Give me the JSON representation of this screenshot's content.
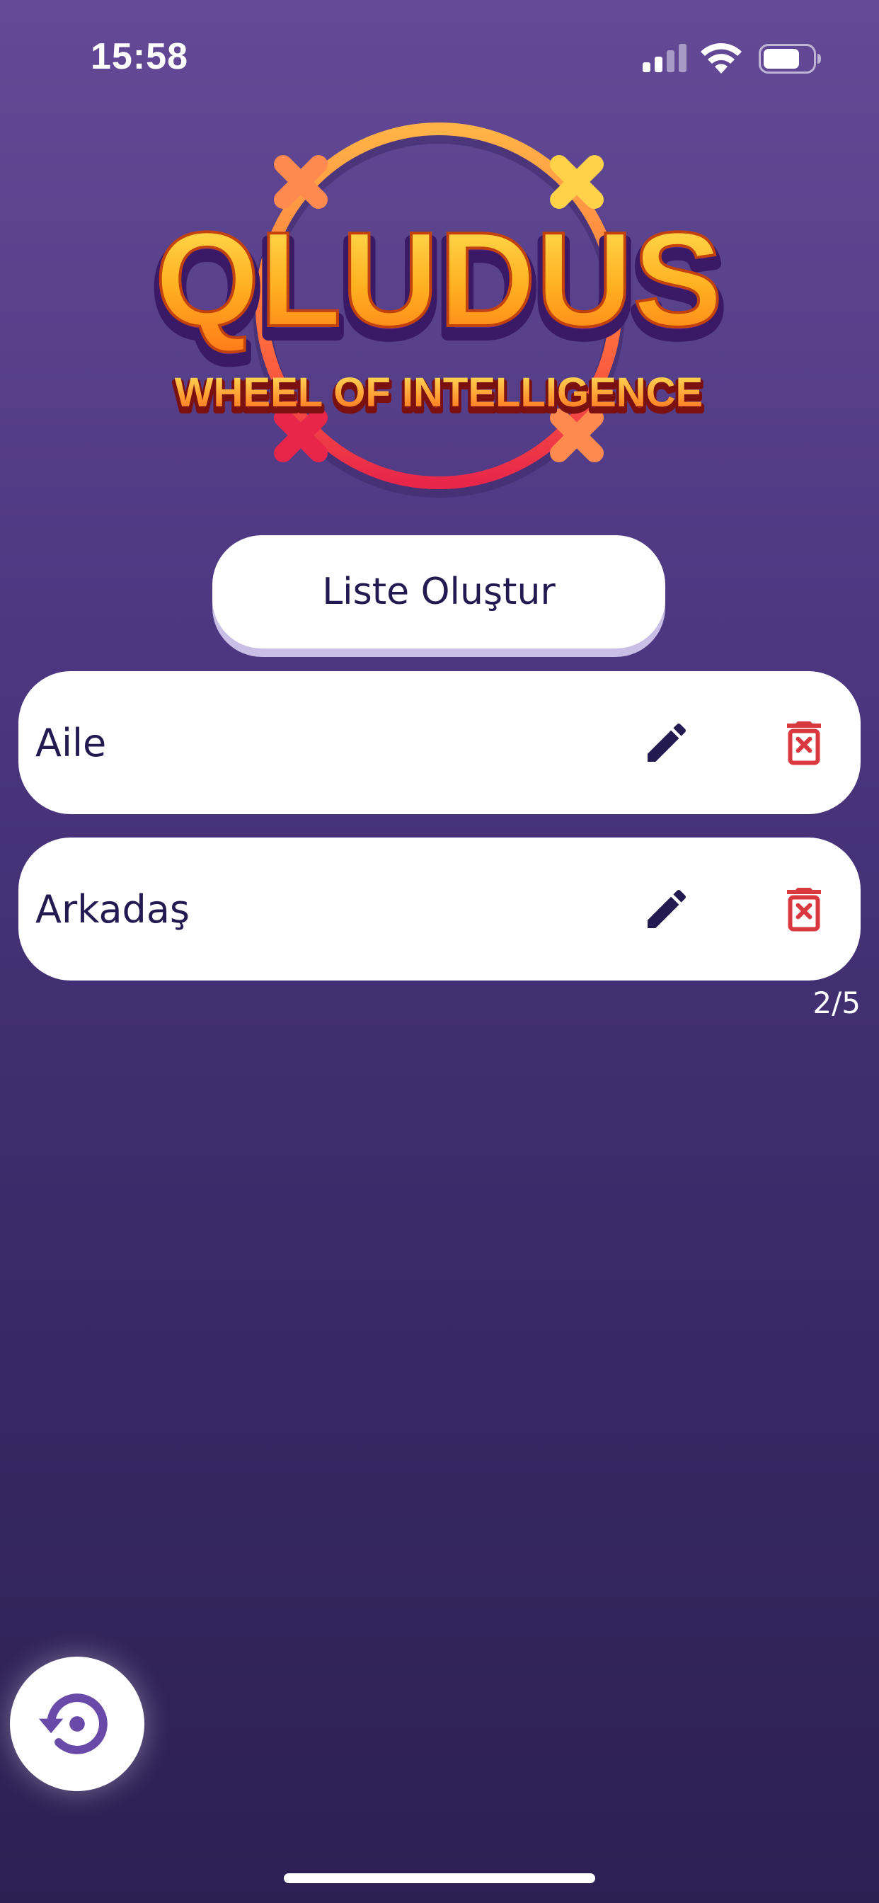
{
  "status_bar": {
    "time": "15:58"
  },
  "logo": {
    "title": "QLUDUS",
    "subtitle": "WHEEL OF INTELLIGENCE"
  },
  "create_button": {
    "label": "Liste Oluştur"
  },
  "lists": [
    {
      "name": "Aile"
    },
    {
      "name": "Arkadaş"
    }
  ],
  "list_count": "2/5",
  "colors": {
    "background_top": "#644a96",
    "background_bottom": "#2c2053",
    "text_dark": "#241a52",
    "delete_red": "#d9383f",
    "fab_icon": "#6a4aa8"
  },
  "icons": {
    "edit": "pencil-icon",
    "delete": "trash-x-icon",
    "reset": "restore-icon"
  }
}
